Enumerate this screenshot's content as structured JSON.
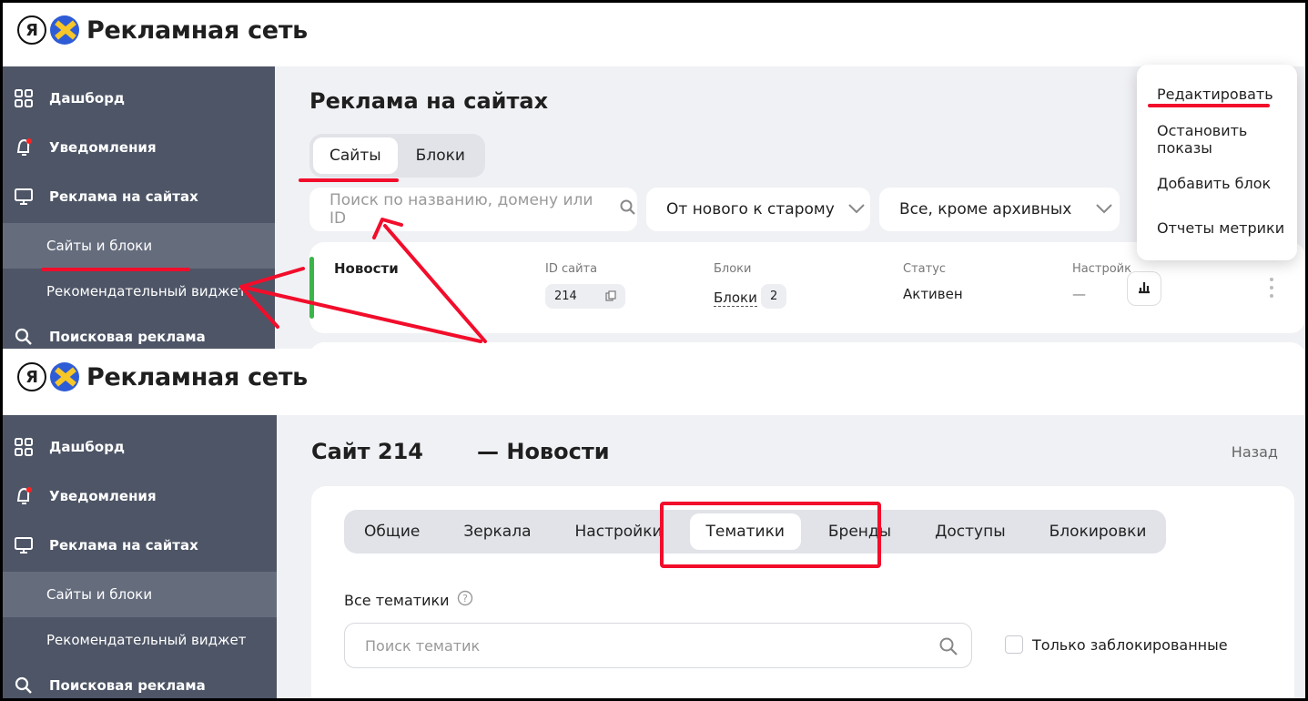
{
  "brand": {
    "name": "Рекламная сеть",
    "logo_letter": "Я"
  },
  "sidebar": {
    "items": [
      {
        "label": "Дашборд",
        "icon": "grid-icon"
      },
      {
        "label": "Уведомления",
        "icon": "bell-icon"
      },
      {
        "label": "Реклама на сайтах",
        "icon": "monitor-icon"
      },
      {
        "label": "Сайты и блоки"
      },
      {
        "label": "Рекомендательный виджет"
      },
      {
        "label": "Поисковая реклама",
        "icon": "search-icon"
      }
    ]
  },
  "sites_page": {
    "title": "Реклама на сайтах",
    "tabs": [
      "Сайты",
      "Блоки"
    ],
    "search_placeholder": "Поиск по названию, домену или ID",
    "sort_value": "От нового к старому",
    "filter_value": "Все, кроме архивных",
    "row": {
      "name": "Новости",
      "id_label": "ID сайта",
      "id_value": "214",
      "blocks_label": "Блоки",
      "blocks_link": "Блоки",
      "blocks_count": "2",
      "status_label": "Статус",
      "status_value": "Активен",
      "settings_label": "Настройк",
      "settings_value": "—"
    },
    "menu": [
      "Редактировать",
      "Остановить показы",
      "Добавить блок",
      "Отчеты метрики"
    ]
  },
  "site_page": {
    "title_site": "Сайт 214",
    "title_name": "— Новости",
    "back_label": "Назад",
    "tabs": [
      "Общие",
      "Зеркала",
      "Настройки",
      "Тематики",
      "Бренды",
      "Доступы",
      "Блокировки"
    ],
    "topics_label": "Все тематики",
    "topics_search_placeholder": "Поиск тематик",
    "only_blocked_label": "Только заблокированные"
  },
  "colors": {
    "sidebar": "#4d5566",
    "sidebar_active": "#656d7d",
    "background": "#f0f1f4",
    "annotation": "#f20d2b",
    "status_bar": "#3bb54a"
  }
}
